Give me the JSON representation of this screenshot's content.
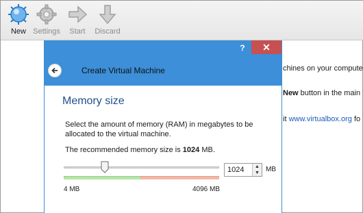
{
  "toolbar": {
    "new_label": "New",
    "settings_label": "Settings",
    "start_label": "Start",
    "discard_label": "Discard"
  },
  "background": {
    "line1": "chines on your computer.",
    "line2_bold": "New",
    "line2_rest": " button in the main",
    "line3_pre": "it ",
    "line3_link": "www.virtualbox.org",
    "line3_post": " fo"
  },
  "dialog": {
    "help": "?",
    "close": "✕",
    "title": "Create Virtual Machine",
    "section_title": "Memory size",
    "description": "Select the amount of memory (RAM) in megabytes to be allocated to the virtual machine.",
    "recommended_prefix": "The recommended memory size is ",
    "recommended_value": "1024",
    "recommended_suffix": " MB.",
    "memory": {
      "value": "1024",
      "unit": "MB",
      "min_label": "4 MB",
      "max_label": "4096 MB",
      "level_fraction": 0.25
    }
  },
  "colors": {
    "accent": "#3c8fd8",
    "close": "#c75050",
    "link": "#1a5cb8",
    "section_title": "#1f4e8c"
  }
}
